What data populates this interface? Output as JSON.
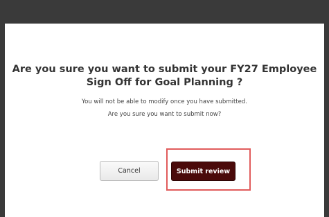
{
  "dialog": {
    "title": "Are you sure you want to submit your FY27 Employee Sign Off for Goal Planning ?",
    "message_line1": "You will not be able to modify once you have submitted.",
    "message_line2": "Are you sure you want to submit now?"
  },
  "buttons": {
    "cancel_label": "Cancel",
    "submit_label": "Submit review"
  },
  "colors": {
    "overlay": "#3a3a3a",
    "submit_bg": "#4a0a0a",
    "highlight_border": "#e15b5b"
  }
}
